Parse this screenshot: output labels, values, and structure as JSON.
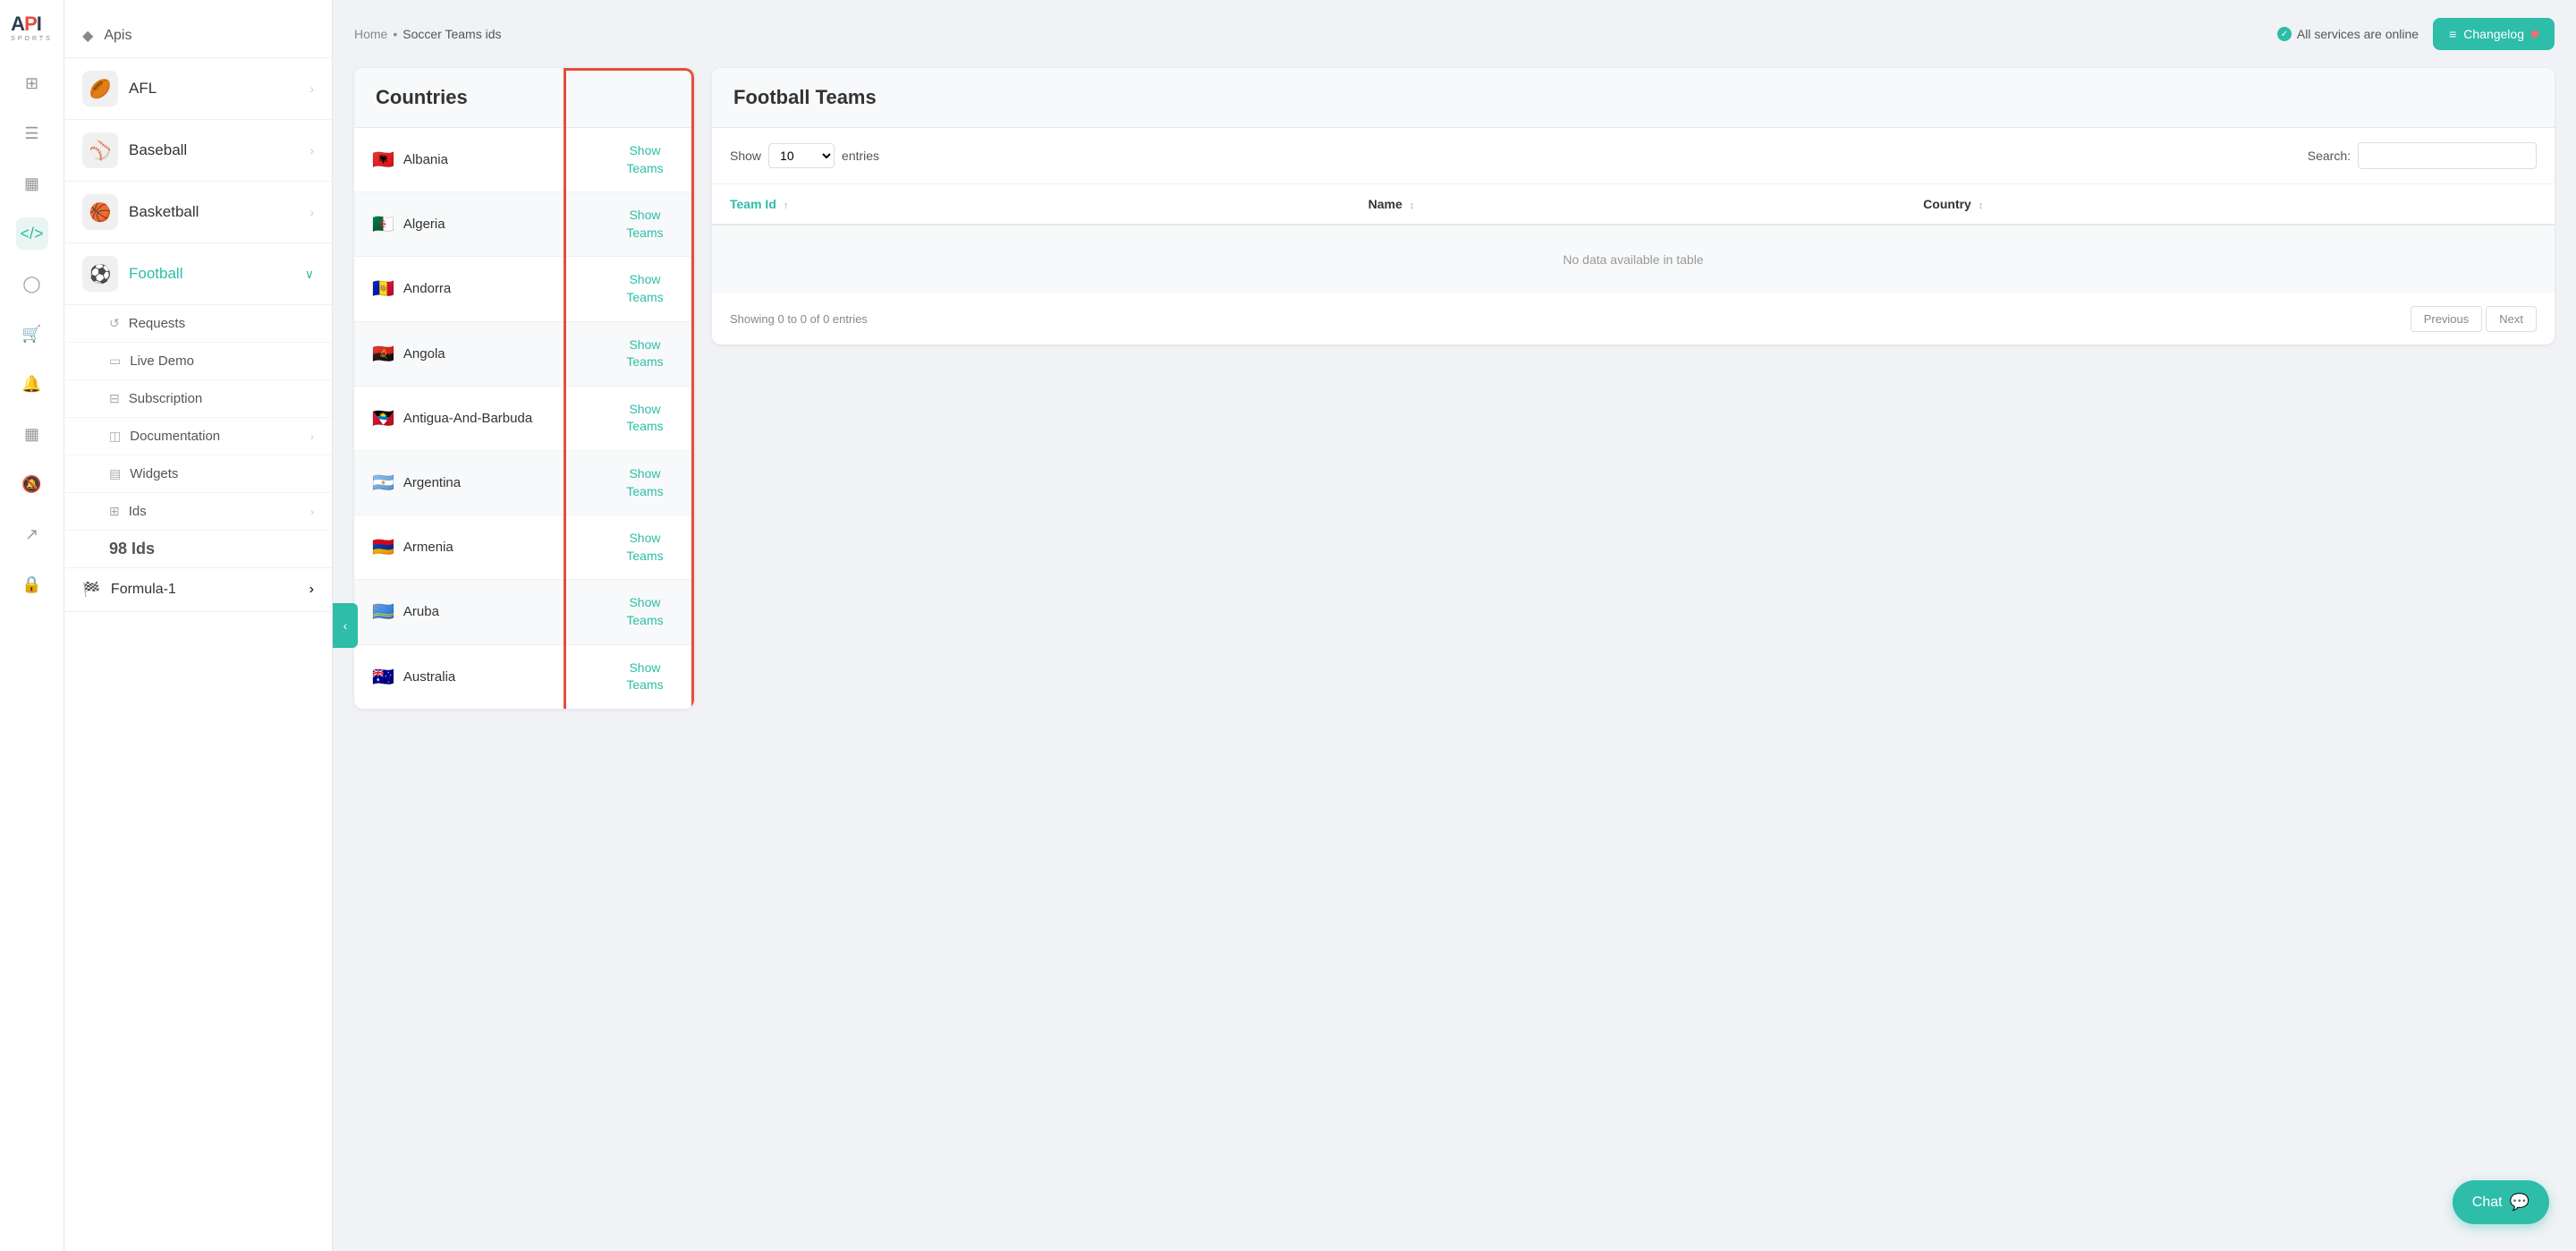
{
  "app": {
    "logo_main": "API",
    "logo_sub": "SPORTS"
  },
  "breadcrumb": {
    "home": "Home",
    "separator": "•",
    "current": "Soccer Teams ids"
  },
  "header": {
    "status_text": "All services are online",
    "changelog_label": "Changelog"
  },
  "icon_sidebar": {
    "icons": [
      {
        "name": "grid-icon",
        "symbol": "⊞",
        "active": false
      },
      {
        "name": "list-icon",
        "symbol": "≡",
        "active": false
      },
      {
        "name": "server-icon",
        "symbol": "▦",
        "active": false
      },
      {
        "name": "code-icon",
        "symbol": "</>",
        "active": true
      },
      {
        "name": "user-icon",
        "symbol": "◯",
        "active": false
      },
      {
        "name": "cart-icon",
        "symbol": "⊕",
        "active": false
      },
      {
        "name": "bell-icon",
        "symbol": "◫",
        "active": false
      },
      {
        "name": "dashboard-icon",
        "symbol": "⊟",
        "active": false
      },
      {
        "name": "notification-icon",
        "symbol": "♜",
        "active": false
      },
      {
        "name": "export-icon",
        "symbol": "↗",
        "active": false
      },
      {
        "name": "lock-icon",
        "symbol": "🔒",
        "active": false
      }
    ]
  },
  "nav_sidebar": {
    "apis_label": "Apis",
    "sports": [
      {
        "id": "afl",
        "label": "AFL",
        "emoji": "🏉",
        "active": false,
        "has_submenu": true
      },
      {
        "id": "baseball",
        "label": "Baseball",
        "emoji": "⚾",
        "active": false,
        "has_submenu": true
      },
      {
        "id": "basketball",
        "label": "Basketball",
        "emoji": "🏀",
        "active": false,
        "has_submenu": true
      },
      {
        "id": "football",
        "label": "Football",
        "emoji": "⚽",
        "active": true,
        "has_submenu": false
      }
    ],
    "football_submenu": [
      {
        "id": "requests",
        "label": "Requests",
        "icon": "↺",
        "has_chevron": false
      },
      {
        "id": "live-demo",
        "label": "Live Demo",
        "icon": "▭",
        "has_chevron": false
      },
      {
        "id": "subscription",
        "label": "Subscription",
        "icon": "⊟",
        "has_chevron": false
      },
      {
        "id": "documentation",
        "label": "Documentation",
        "icon": "◫",
        "has_chevron": true
      },
      {
        "id": "widgets",
        "label": "Widgets",
        "icon": "▤",
        "has_chevron": false
      },
      {
        "id": "ids",
        "label": "Ids",
        "icon": "⊞",
        "has_chevron": true
      }
    ],
    "formula1": {
      "label": "Formula-1",
      "emoji": "🏁",
      "has_submenu": true
    },
    "ids_count_label": "98 Ids"
  },
  "countries_panel": {
    "title": "Countries",
    "countries": [
      {
        "name": "Albania",
        "flag": "🇦🇱"
      },
      {
        "name": "Algeria",
        "flag": "🇩🇿"
      },
      {
        "name": "Andorra",
        "flag": "🇦🇩"
      },
      {
        "name": "Angola",
        "flag": "🇦🇴"
      },
      {
        "name": "Antigua-And-Barbuda",
        "flag": "🇦🇬"
      },
      {
        "name": "Argentina",
        "flag": "🇦🇷"
      },
      {
        "name": "Armenia",
        "flag": "🇦🇲"
      },
      {
        "name": "Aruba",
        "flag": "🇦🇼"
      },
      {
        "name": "Australia",
        "flag": "🇦🇺"
      }
    ],
    "show_teams_label": "Show Teams"
  },
  "teams_panel": {
    "title": "Football Teams",
    "show_label": "Show",
    "entries_label": "entries",
    "entries_value": "10",
    "search_label": "Search:",
    "search_placeholder": "",
    "columns": [
      {
        "key": "team_id",
        "label": "Team Id",
        "sort": "active"
      },
      {
        "key": "name",
        "label": "Name",
        "sort": "both"
      },
      {
        "key": "country",
        "label": "Country",
        "sort": "both"
      }
    ],
    "no_data": "No data available in table",
    "showing": "Showing 0 to 0 of 0 entries",
    "prev_label": "Previous",
    "next_label": "Next"
  },
  "chat": {
    "label": "Chat"
  },
  "collapse_btn": {
    "symbol": "‹"
  }
}
